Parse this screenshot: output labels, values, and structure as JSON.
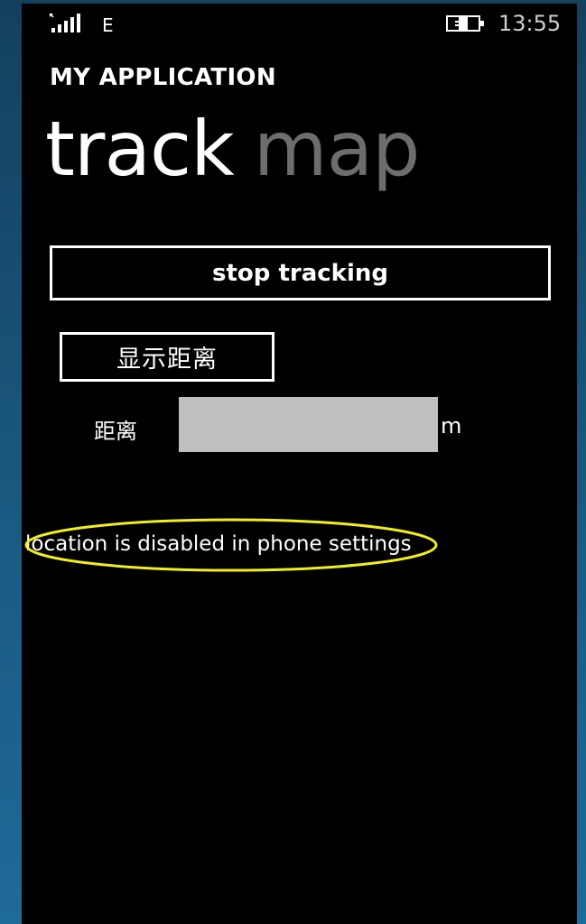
{
  "status_bar": {
    "signal_icon": "signal-strength-icon",
    "network_type": "E",
    "battery_icon": "battery-charging-icon",
    "time": "13:55"
  },
  "app": {
    "title": "MY APPLICATION"
  },
  "pivot": {
    "items": [
      {
        "label": "track",
        "active": true
      },
      {
        "label": "map",
        "active": false
      }
    ]
  },
  "main": {
    "stop_button_label": "stop tracking",
    "show_distance_button_label": "显示距离",
    "distance_label": "距离",
    "distance_value": "",
    "distance_unit": "m",
    "status_message": "location is disabled in phone settings"
  },
  "colors": {
    "background": "#000000",
    "text": "#ffffff",
    "inactive_pivot": "#6d6d6d",
    "input_background": "#bfbfbf",
    "annotation": "#ffff00"
  }
}
